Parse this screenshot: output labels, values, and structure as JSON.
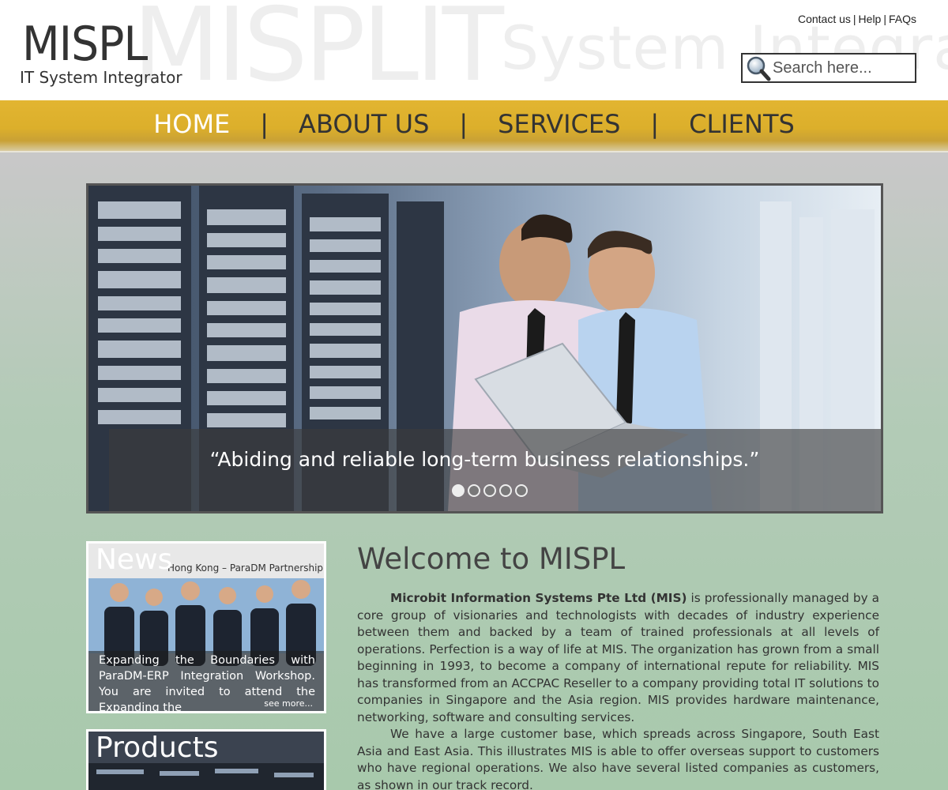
{
  "header": {
    "logo_title": "MISPL",
    "logo_subtitle": "IT System Integrator",
    "watermark_big": "MISPLIT",
    "watermark_small": "System Integrat",
    "top_links": [
      "Contact us",
      "Help",
      "FAQs"
    ],
    "search_placeholder": "Search here..."
  },
  "nav": {
    "items": [
      {
        "label": "HOME",
        "active": true
      },
      {
        "label": "ABOUT US",
        "active": false
      },
      {
        "label": "SERVICES",
        "active": false
      },
      {
        "label": "CLIENTS",
        "active": false
      }
    ],
    "separator": "|"
  },
  "hero": {
    "caption": "“Abiding and reliable long-term business relationships.”",
    "slide_count": 5,
    "active_slide": 1
  },
  "news": {
    "title": "News",
    "image_banner_text": "Hong Kong – ParaDM Partnership",
    "body": "Expanding the Boundaries with ParaDM-ERP Integration Workshop. You are invited to attend the Expanding the",
    "see_more": "see more..."
  },
  "products": {
    "title": "Products"
  },
  "welcome": {
    "title": "Welcome to MISPL",
    "p1_strong": "Microbit Information Systems Pte Ltd (MIS)",
    "p1_rest": " is professionally managed by a core group of visionaries and technologists with decades of industry experience between them and backed by a team of trained professionals at all levels of operations. Perfection is a way of life at MIS. The organization has grown from a small beginning in 1993, to become a company of international repute for reliability. MIS has transformed from an ACCPAC Reseller to a company providing total IT solutions to companies in Singapore and the Asia region. MIS provides hardware maintenance, networking, software and consulting services.",
    "p2": "We have a large customer base, which spreads across Singapore, South East Asia and East Asia. This illustrates MIS is able to offer overseas support to customers who have regional operations. We also have several listed companies as customers, as shown in our track record."
  },
  "colors": {
    "nav_gold": "#dcaf2b",
    "nav_active": "#ffffff",
    "text_dark": "#333333"
  }
}
